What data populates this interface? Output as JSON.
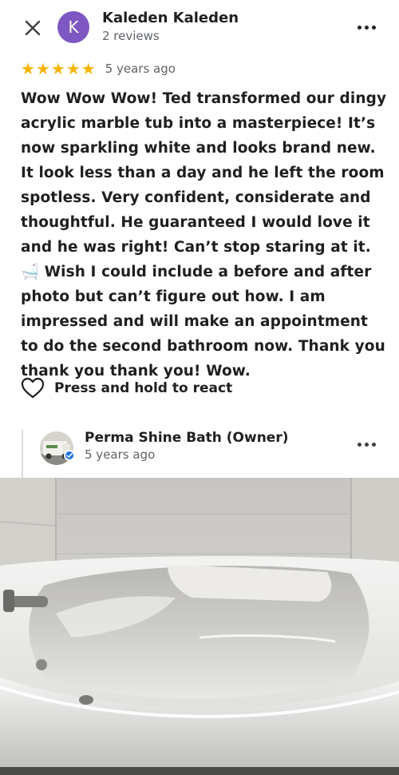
{
  "review": {
    "reviewer_initial": "K",
    "reviewer_name": "Kaleden Kaleden",
    "reviewer_reviews": "2 reviews",
    "rating": 5,
    "stars": [
      "★",
      "★",
      "★",
      "★",
      "★"
    ],
    "time_ago": "5 years ago",
    "text": "Wow Wow Wow! Ted transformed our dingy acrylic marble tub into a masterpiece!  It’s now sparkling white and looks brand new. It look less than a day and he left the room spotless. Very confident, considerate and thoughtful. He guaranteed I would love it and he was right!  Can’t stop staring at it. 🛁 Wish I could include a before and after photo but can’t figure out how. I am impressed and will make an appointment to do the second bathroom now. Thank you thank you thank you! Wow."
  },
  "react": {
    "label": "Press and hold to react"
  },
  "owner_reply": {
    "name": "Perma Shine Bath (Owner)",
    "time_ago": "5 years ago"
  },
  "icons": {
    "close": "close-icon",
    "more": "more-vert-icon",
    "heart": "heart-icon",
    "verified": "verified-check-icon"
  },
  "colors": {
    "avatar_bg": "#7e57c2",
    "star": "#f6b400",
    "secondary_text": "#5f6368",
    "verified": "#1a73e8"
  }
}
